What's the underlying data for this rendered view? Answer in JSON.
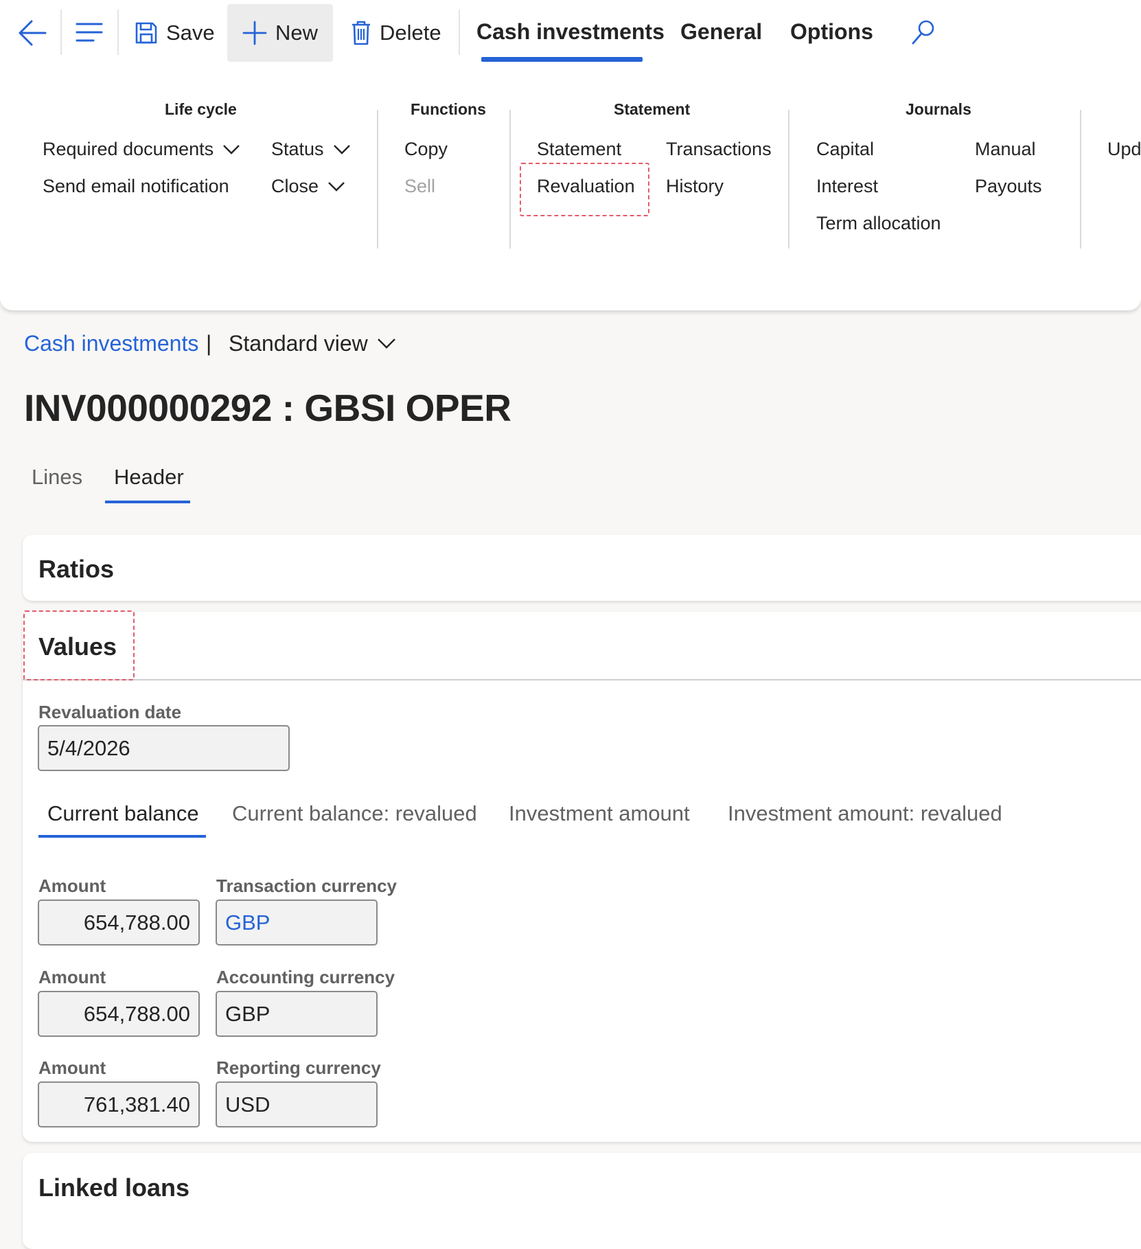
{
  "toolbar": {
    "save_label": "Save",
    "new_label": "New",
    "delete_label": "Delete",
    "tabs": [
      {
        "label": "Cash investments",
        "active": true
      },
      {
        "label": "General"
      },
      {
        "label": "Options"
      }
    ]
  },
  "ribbon": {
    "life_cycle": {
      "title": "Life cycle",
      "items": [
        "Required documents",
        "Status",
        "Send email notification",
        "Close"
      ]
    },
    "functions": {
      "title": "Functions",
      "items": [
        "Copy",
        "Sell"
      ]
    },
    "statement": {
      "title": "Statement",
      "items": [
        "Statement",
        "Transactions",
        "Revaluation",
        "History"
      ]
    },
    "journals": {
      "title": "Journals",
      "items": [
        "Capital",
        "Manual",
        "Interest",
        "Payouts",
        "Term allocation"
      ]
    },
    "overflow_label": "Upd"
  },
  "breadcrumb": {
    "link": "Cash investments",
    "separator": "|",
    "view": "Standard view"
  },
  "page": {
    "title": "INV000000292 : GBSI OPER",
    "tabs": [
      "Lines",
      "Header"
    ],
    "active_tab": "Header"
  },
  "sections": {
    "ratios": "Ratios",
    "values": "Values",
    "linked_loans": "Linked loans"
  },
  "values": {
    "revaluation_date_label": "Revaluation date",
    "revaluation_date": "5/4/2026",
    "subtabs": [
      "Current balance",
      "Current balance: revalued",
      "Investment amount",
      "Investment amount: revalued"
    ],
    "active_subtab": "Current balance",
    "rows": [
      {
        "amount_label": "Amount",
        "amount": "654,788.00",
        "currency_label": "Transaction currency",
        "currency": "GBP"
      },
      {
        "amount_label": "Amount",
        "amount": "654,788.00",
        "currency_label": "Accounting currency",
        "currency": "GBP"
      },
      {
        "amount_label": "Amount",
        "amount": "761,381.40",
        "currency_label": "Reporting currency",
        "currency": "USD"
      }
    ]
  },
  "colors": {
    "accent": "#2563d7",
    "highlight": "#e35b6a"
  }
}
